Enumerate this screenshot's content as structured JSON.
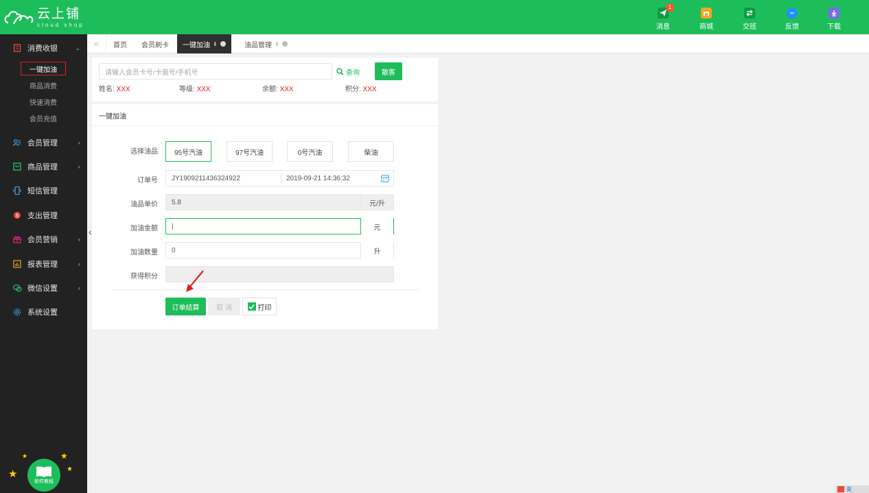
{
  "brand": {
    "title": "云上铺",
    "subtitle": "cloud shop"
  },
  "top_nav": [
    {
      "label": "消息",
      "badge": "1",
      "color": "#0e9a42"
    },
    {
      "label": "商城",
      "color": "#f5a623"
    },
    {
      "label": "交班",
      "color": "#0e9a42"
    },
    {
      "label": "反馈",
      "color": "#1e90ff"
    },
    {
      "label": "下载",
      "color": "#7b68ee"
    }
  ],
  "sidebar": {
    "menus": [
      {
        "label": "消费收银",
        "arrow": "⌄"
      },
      {
        "label": "会员管理",
        "arrow": "‹"
      },
      {
        "label": "商品管理",
        "arrow": "‹"
      },
      {
        "label": "短信管理"
      },
      {
        "label": "支出管理"
      },
      {
        "label": "会员营销",
        "arrow": "‹"
      },
      {
        "label": "报表管理",
        "arrow": "‹"
      },
      {
        "label": "微信设置",
        "arrow": "‹"
      },
      {
        "label": "系统设置"
      }
    ],
    "sub_items": [
      "一键加油",
      "商品消费",
      "快速消费",
      "会员充值"
    ],
    "tutorial_label": "软件教程"
  },
  "tabs": [
    "首页",
    "会员刷卡",
    "一键加油",
    "油品管理"
  ],
  "search": {
    "placeholder": "请输入会员卡号/卡面号/手机号",
    "query_label": "查询",
    "guest_label": "散客"
  },
  "member": {
    "name_label": "姓名:",
    "name_value": "XXX",
    "level_label": "等级:",
    "level_value": "XXX",
    "balance_label": "余额:",
    "balance_value": "XXX",
    "points_label": "积分:",
    "points_value": "XXX"
  },
  "section_title": "一键加油",
  "form": {
    "oil_label": "选择油品",
    "oils": [
      "95号汽油",
      "97号汽油",
      "0号汽油",
      "柴油"
    ],
    "order_label": "订单号",
    "order_no": "JY1909211436324922",
    "order_time": "2019-09-21 14:36:32",
    "price_label": "油品单价",
    "price_value": "5.8",
    "price_unit": "元/升",
    "amount_label": "加油金额",
    "amount_value": "|",
    "amount_unit": "元",
    "quantity_label": "加油数量",
    "quantity_value": "0",
    "quantity_unit": "升",
    "points_label": "获得积分",
    "points_value": ""
  },
  "actions": {
    "submit": "订单结算",
    "cancel": "取 消",
    "print": "打印"
  },
  "ime_badge": "英"
}
